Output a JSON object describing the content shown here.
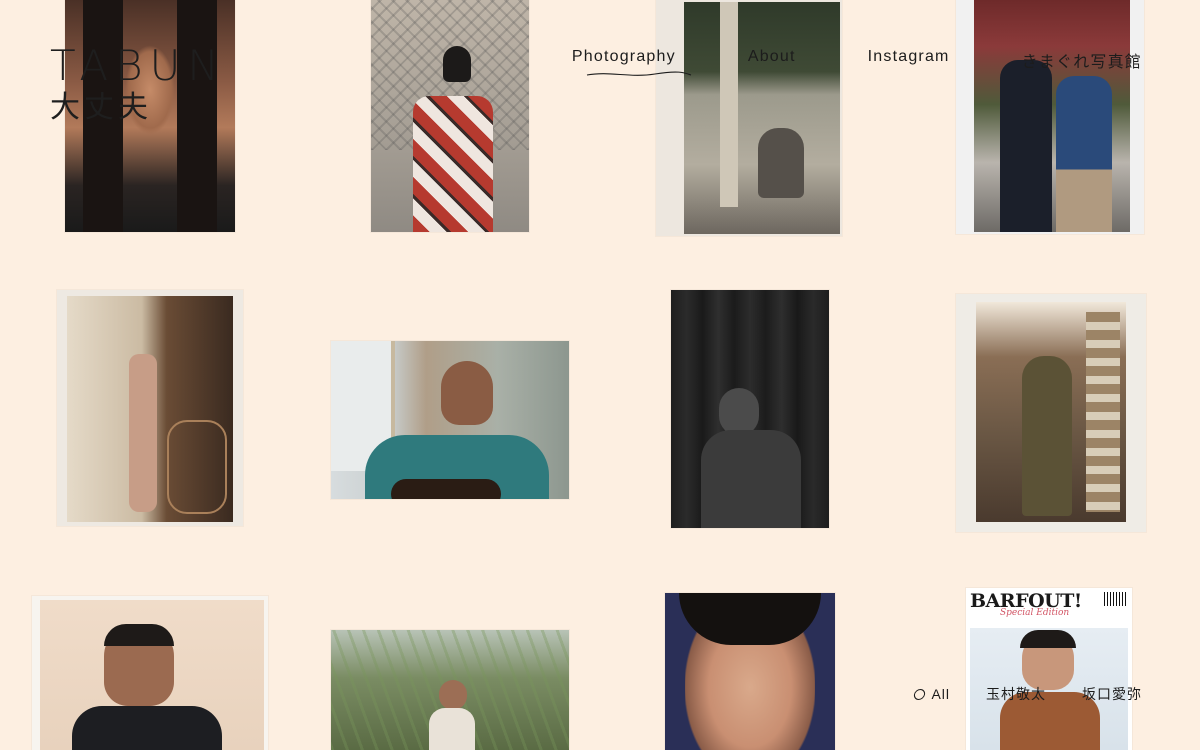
{
  "brand": {
    "name": "TABUN",
    "subtitle": "大丈夫"
  },
  "nav": {
    "items": [
      {
        "label": "Photography",
        "active": true
      },
      {
        "label": "About"
      },
      {
        "label": "Instagram"
      },
      {
        "label": "きまぐれ写真館"
      }
    ]
  },
  "filter": {
    "items": [
      {
        "label": "All",
        "active": true
      },
      {
        "label": "玉村敬太"
      },
      {
        "label": "坂口愛弥"
      }
    ]
  },
  "magazine": {
    "title": "BARFOUT!",
    "edition": "Special Edition"
  },
  "colors": {
    "background": "#fdefe1",
    "text": "#1c1c1c"
  }
}
